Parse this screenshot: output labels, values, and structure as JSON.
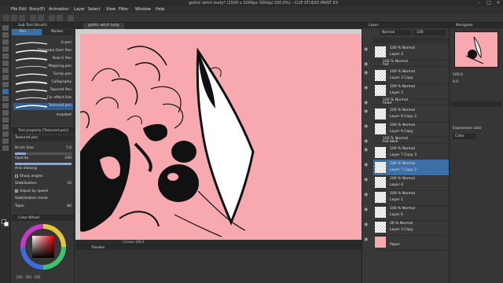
{
  "window": {
    "title": "gothic witch body* (2500 x 2000px 300dpi 100.0%) - CLIP STUDIO PAINT EX"
  },
  "menu": [
    "File",
    "Edit",
    "Story(P)",
    "Animation",
    "Layer",
    "Select",
    "View",
    "Filter",
    "Window",
    "Help"
  ],
  "subtool": {
    "header": "Sub Tool [Brush]",
    "tabs": [
      "Pen",
      "Marker"
    ],
    "brushes": [
      {
        "label": "G-pen"
      },
      {
        "label": "Shinwaka Geer Pen"
      },
      {
        "label": "Real G Pen"
      },
      {
        "label": "Mapping pen"
      },
      {
        "label": "Turnip pen"
      },
      {
        "label": "Calligraphy"
      },
      {
        "label": "Tapered Pen"
      },
      {
        "label": "For effect line"
      },
      {
        "label": "Textured pen"
      },
      {
        "label": "mapsket"
      }
    ]
  },
  "tool_property": {
    "header": "Tool property [Textured pen]",
    "brush_name": "Textured pen",
    "brush_size_label": "Brush Size",
    "brush_size_value": "7.0",
    "opacity_label": "Opacity",
    "opacity_value": "100",
    "opacity_level": 1.0,
    "antialiasing_label": "Anti-aliasing",
    "sharp_angles_label": "Sharp angles",
    "stabilization_label": "Stabilization",
    "stabilization_value": "10",
    "adjust_speed_label": "Adjust by speed",
    "stabilization_mode_label": "Stabilization mode",
    "taper_label": "Taper",
    "taper_value": "80"
  },
  "color_panel": {
    "header": "Color Wheel",
    "readout": "255 · 255 · 255",
    "current_color": "#d84a4a"
  },
  "document": {
    "tab_label": "gothic witch body",
    "canvas_color": "#f7a9af",
    "status": "Canvas 100.0"
  },
  "timeline": {
    "header": "Timeline"
  },
  "layer_panel": {
    "header": "Layer",
    "blend_mode": "Normal",
    "opacity": "100",
    "layers": [
      {
        "l1": "100 % Normal",
        "l2": "Layer 2",
        "kind": "layer"
      },
      {
        "l1": "100 % Normal",
        "l2": "hat",
        "kind": "folder"
      },
      {
        "l1": "100 % Normal",
        "l2": "Layer 3 Copy",
        "kind": "layer"
      },
      {
        "l1": "100 % Normal",
        "l2": "Layer 3",
        "kind": "layer"
      },
      {
        "l1": "100 % Normal",
        "l2": "head",
        "kind": "folder"
      },
      {
        "l1": "100 % Normal",
        "l2": "Layer 6 Copy 2",
        "kind": "layer"
      },
      {
        "l1": "100 % Normal",
        "l2": "Layer 6 Copy",
        "kind": "layer"
      },
      {
        "l1": "100 % Normal",
        "l2": "hat back",
        "kind": "folder"
      },
      {
        "l1": "100 % Normal",
        "l2": "Layer 7 Copy 3",
        "kind": "layer"
      },
      {
        "l1": "100 % Normal",
        "l2": "Layer 7 Copy 2",
        "kind": "layer",
        "selected": true
      },
      {
        "l1": "100 % Normal",
        "l2": "Layer 4",
        "kind": "layer"
      },
      {
        "l1": "100 % Normal",
        "l2": "Layer 1",
        "kind": "layer"
      },
      {
        "l1": "100 % Normal",
        "l2": "Layer 6",
        "kind": "layer"
      },
      {
        "l1": "26 % Normal",
        "l2": "Layer 3 Copy",
        "kind": "layer"
      },
      {
        "l1": "",
        "l2": "Paper",
        "kind": "paper"
      }
    ]
  },
  "navigator": {
    "header": "Navigator",
    "zoom": "100.0",
    "rotation": "0.0"
  },
  "expression": {
    "label": "Expression color",
    "value": "Color"
  }
}
